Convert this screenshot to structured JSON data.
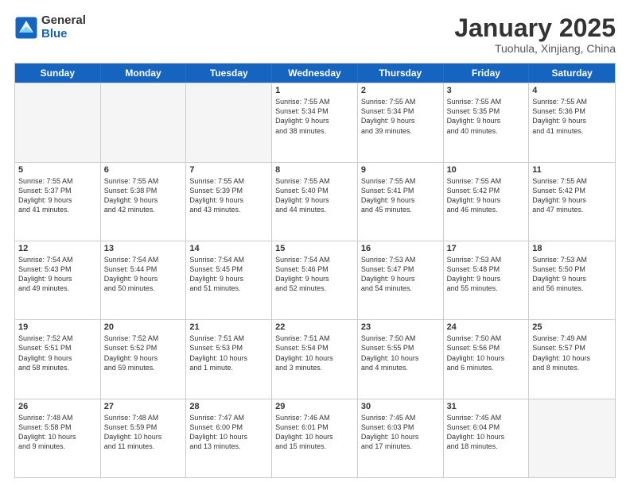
{
  "logo": {
    "general": "General",
    "blue": "Blue"
  },
  "title": "January 2025",
  "subtitle": "Tuohula, Xinjiang, China",
  "header_days": [
    "Sunday",
    "Monday",
    "Tuesday",
    "Wednesday",
    "Thursday",
    "Friday",
    "Saturday"
  ],
  "weeks": [
    [
      {
        "day": "",
        "content": ""
      },
      {
        "day": "",
        "content": ""
      },
      {
        "day": "",
        "content": ""
      },
      {
        "day": "1",
        "content": "Sunrise: 7:55 AM\nSunset: 5:34 PM\nDaylight: 9 hours\nand 38 minutes."
      },
      {
        "day": "2",
        "content": "Sunrise: 7:55 AM\nSunset: 5:34 PM\nDaylight: 9 hours\nand 39 minutes."
      },
      {
        "day": "3",
        "content": "Sunrise: 7:55 AM\nSunset: 5:35 PM\nDaylight: 9 hours\nand 40 minutes."
      },
      {
        "day": "4",
        "content": "Sunrise: 7:55 AM\nSunset: 5:36 PM\nDaylight: 9 hours\nand 41 minutes."
      }
    ],
    [
      {
        "day": "5",
        "content": "Sunrise: 7:55 AM\nSunset: 5:37 PM\nDaylight: 9 hours\nand 41 minutes."
      },
      {
        "day": "6",
        "content": "Sunrise: 7:55 AM\nSunset: 5:38 PM\nDaylight: 9 hours\nand 42 minutes."
      },
      {
        "day": "7",
        "content": "Sunrise: 7:55 AM\nSunset: 5:39 PM\nDaylight: 9 hours\nand 43 minutes."
      },
      {
        "day": "8",
        "content": "Sunrise: 7:55 AM\nSunset: 5:40 PM\nDaylight: 9 hours\nand 44 minutes."
      },
      {
        "day": "9",
        "content": "Sunrise: 7:55 AM\nSunset: 5:41 PM\nDaylight: 9 hours\nand 45 minutes."
      },
      {
        "day": "10",
        "content": "Sunrise: 7:55 AM\nSunset: 5:42 PM\nDaylight: 9 hours\nand 46 minutes."
      },
      {
        "day": "11",
        "content": "Sunrise: 7:55 AM\nSunset: 5:42 PM\nDaylight: 9 hours\nand 47 minutes."
      }
    ],
    [
      {
        "day": "12",
        "content": "Sunrise: 7:54 AM\nSunset: 5:43 PM\nDaylight: 9 hours\nand 49 minutes."
      },
      {
        "day": "13",
        "content": "Sunrise: 7:54 AM\nSunset: 5:44 PM\nDaylight: 9 hours\nand 50 minutes."
      },
      {
        "day": "14",
        "content": "Sunrise: 7:54 AM\nSunset: 5:45 PM\nDaylight: 9 hours\nand 51 minutes."
      },
      {
        "day": "15",
        "content": "Sunrise: 7:54 AM\nSunset: 5:46 PM\nDaylight: 9 hours\nand 52 minutes."
      },
      {
        "day": "16",
        "content": "Sunrise: 7:53 AM\nSunset: 5:47 PM\nDaylight: 9 hours\nand 54 minutes."
      },
      {
        "day": "17",
        "content": "Sunrise: 7:53 AM\nSunset: 5:48 PM\nDaylight: 9 hours\nand 55 minutes."
      },
      {
        "day": "18",
        "content": "Sunrise: 7:53 AM\nSunset: 5:50 PM\nDaylight: 9 hours\nand 56 minutes."
      }
    ],
    [
      {
        "day": "19",
        "content": "Sunrise: 7:52 AM\nSunset: 5:51 PM\nDaylight: 9 hours\nand 58 minutes."
      },
      {
        "day": "20",
        "content": "Sunrise: 7:52 AM\nSunset: 5:52 PM\nDaylight: 9 hours\nand 59 minutes."
      },
      {
        "day": "21",
        "content": "Sunrise: 7:51 AM\nSunset: 5:53 PM\nDaylight: 10 hours\nand 1 minute."
      },
      {
        "day": "22",
        "content": "Sunrise: 7:51 AM\nSunset: 5:54 PM\nDaylight: 10 hours\nand 3 minutes."
      },
      {
        "day": "23",
        "content": "Sunrise: 7:50 AM\nSunset: 5:55 PM\nDaylight: 10 hours\nand 4 minutes."
      },
      {
        "day": "24",
        "content": "Sunrise: 7:50 AM\nSunset: 5:56 PM\nDaylight: 10 hours\nand 6 minutes."
      },
      {
        "day": "25",
        "content": "Sunrise: 7:49 AM\nSunset: 5:57 PM\nDaylight: 10 hours\nand 8 minutes."
      }
    ],
    [
      {
        "day": "26",
        "content": "Sunrise: 7:48 AM\nSunset: 5:58 PM\nDaylight: 10 hours\nand 9 minutes."
      },
      {
        "day": "27",
        "content": "Sunrise: 7:48 AM\nSunset: 5:59 PM\nDaylight: 10 hours\nand 11 minutes."
      },
      {
        "day": "28",
        "content": "Sunrise: 7:47 AM\nSunset: 6:00 PM\nDaylight: 10 hours\nand 13 minutes."
      },
      {
        "day": "29",
        "content": "Sunrise: 7:46 AM\nSunset: 6:01 PM\nDaylight: 10 hours\nand 15 minutes."
      },
      {
        "day": "30",
        "content": "Sunrise: 7:45 AM\nSunset: 6:03 PM\nDaylight: 10 hours\nand 17 minutes."
      },
      {
        "day": "31",
        "content": "Sunrise: 7:45 AM\nSunset: 6:04 PM\nDaylight: 10 hours\nand 18 minutes."
      },
      {
        "day": "",
        "content": ""
      }
    ]
  ]
}
